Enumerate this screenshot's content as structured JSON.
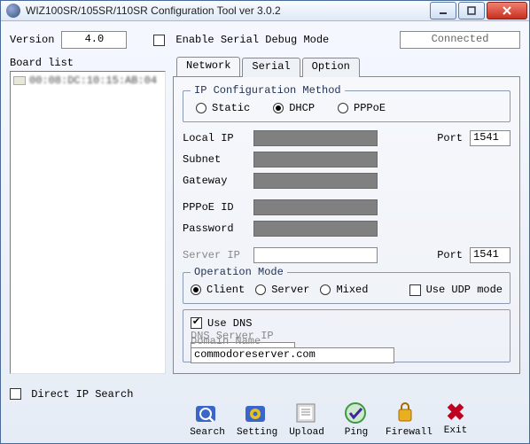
{
  "window": {
    "title": "WIZ100SR/105SR/110SR Configuration Tool ver 3.0.2"
  },
  "top": {
    "version_label": "Version",
    "version_value": "4.0",
    "enable_serial_debug_label": "Enable Serial Debug Mode",
    "enable_serial_debug_checked": false,
    "status": "Connected"
  },
  "board": {
    "label": "Board list",
    "items": [
      {
        "mac": "00:08:DC:10:15:AB:04"
      }
    ]
  },
  "tabs": {
    "network": "Network",
    "serial": "Serial",
    "option": "Option",
    "active": "network"
  },
  "ipmethod": {
    "legend": "IP Configuration Method",
    "static": "Static",
    "dhcp": "DHCP",
    "pppoe": "PPPoE",
    "selected": "dhcp"
  },
  "net": {
    "local_ip_label": "Local IP",
    "local_ip_value": "",
    "port_label": "Port",
    "port_value": "1541",
    "subnet_label": "Subnet",
    "subnet_value": "",
    "gateway_label": "Gateway",
    "gateway_value": "",
    "pppoe_id_label": "PPPoE ID",
    "pppoe_id_value": "",
    "password_label": "Password",
    "password_value": "",
    "server_ip_label": "Server IP",
    "server_ip_value": "",
    "server_port_label": "Port",
    "server_port_value": "1541"
  },
  "opmode": {
    "legend": "Operation Mode",
    "client": "Client",
    "server": "Server",
    "mixed": "Mixed",
    "selected": "client",
    "use_udp_label": "Use UDP mode",
    "use_udp_checked": false
  },
  "dns": {
    "use_dns_label": "Use DNS",
    "use_dns_checked": true,
    "server_ip_label": "DNS Server IP",
    "server_ip_value": "",
    "domain_label": "Domain Name",
    "domain_value": "commodoreserver.com"
  },
  "direct_ip": {
    "label": "Direct IP Search",
    "checked": false
  },
  "toolbar": {
    "search": "Search",
    "setting": "Setting",
    "upload": "Upload",
    "ping": "Ping",
    "firewall": "Firewall",
    "exit": "Exit"
  }
}
